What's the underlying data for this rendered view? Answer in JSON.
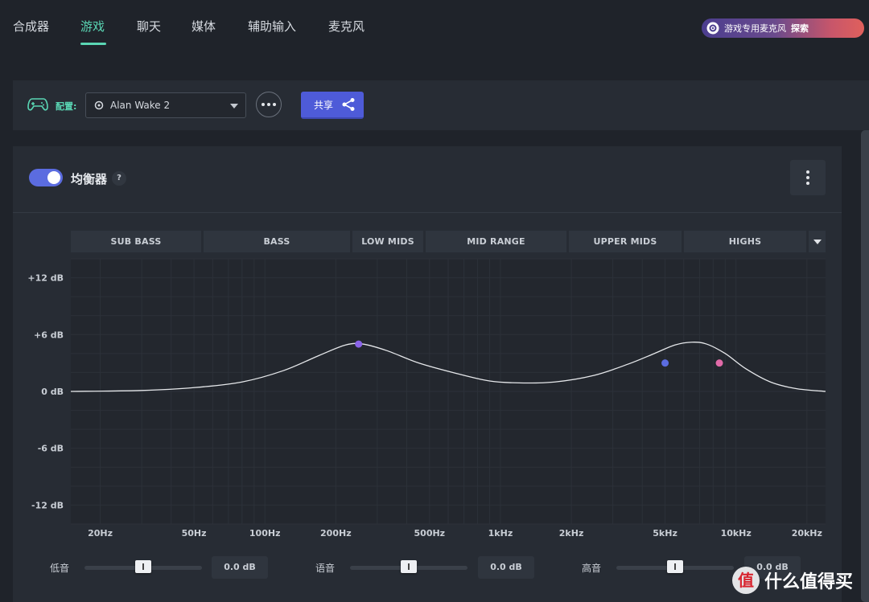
{
  "nav": {
    "tabs": [
      {
        "label": "合成器"
      },
      {
        "label": "游戏"
      },
      {
        "label": "聊天"
      },
      {
        "label": "媒体"
      },
      {
        "label": "辅助输入"
      },
      {
        "label": "麦克风"
      }
    ],
    "active_tab": "游戏",
    "promo": {
      "text": "游戏专用麦克风",
      "cta": "探索"
    }
  },
  "toolbar": {
    "config_label": "配置:",
    "profile": "Alan Wake 2",
    "share_label": "共享"
  },
  "equalizer": {
    "title": "均衡器",
    "help": "?",
    "enabled": true,
    "bands": [
      {
        "label": "SUB BASS"
      },
      {
        "label": "BASS"
      },
      {
        "label": "LOW MIDS"
      },
      {
        "label": "MID RANGE"
      },
      {
        "label": "UPPER MIDS"
      },
      {
        "label": "HIGHS"
      }
    ]
  },
  "chart_data": {
    "type": "line",
    "x_scale": "log",
    "xlim": [
      15,
      24000
    ],
    "ylim": [
      -14,
      14
    ],
    "y_ticks": [
      {
        "label": "+12 dB",
        "value": 12
      },
      {
        "label": "+6 dB",
        "value": 6
      },
      {
        "label": "0 dB",
        "value": 0
      },
      {
        "label": "-6 dB",
        "value": -6
      },
      {
        "label": "-12 dB",
        "value": -12
      }
    ],
    "x_ticks": [
      {
        "label": "20Hz",
        "value": 20
      },
      {
        "label": "50Hz",
        "value": 50
      },
      {
        "label": "100Hz",
        "value": 100
      },
      {
        "label": "200Hz",
        "value": 200
      },
      {
        "label": "500Hz",
        "value": 500
      },
      {
        "label": "1kHz",
        "value": 1000
      },
      {
        "label": "2kHz",
        "value": 2000
      },
      {
        "label": "5kHz",
        "value": 5000
      },
      {
        "label": "10kHz",
        "value": 10000
      },
      {
        "label": "20kHz",
        "value": 20000
      }
    ],
    "curve": {
      "x": [
        15,
        30,
        50,
        80,
        120,
        170,
        220,
        260,
        330,
        450,
        650,
        900,
        1200,
        1700,
        2500,
        3500,
        4500,
        5500,
        6500,
        7500,
        9000,
        11000,
        14000,
        18000,
        24000
      ],
      "y": [
        0,
        0.1,
        0.4,
        1.0,
        2.2,
        3.8,
        4.9,
        5.0,
        4.3,
        3.0,
        1.9,
        1.1,
        0.9,
        1.0,
        1.7,
        2.9,
        4.0,
        4.9,
        5.2,
        5.0,
        4.0,
        2.4,
        1.0,
        0.3,
        0
      ]
    },
    "points": [
      {
        "x": 250,
        "y": 5.0,
        "color": "#8a63e8"
      },
      {
        "x": 5000,
        "y": 3.0,
        "color": "#5b6ce0"
      },
      {
        "x": 8500,
        "y": 3.0,
        "color": "#e06aa8"
      }
    ],
    "grid": true
  },
  "sliders": [
    {
      "label": "低音",
      "value": "0.0 dB",
      "level": 0.5
    },
    {
      "label": "语音",
      "value": "0.0 dB",
      "level": 0.5
    },
    {
      "label": "高音",
      "value": "0.0 dB",
      "level": 0.5
    }
  ],
  "watermark": {
    "logo": "值",
    "text": "什么值得买"
  }
}
